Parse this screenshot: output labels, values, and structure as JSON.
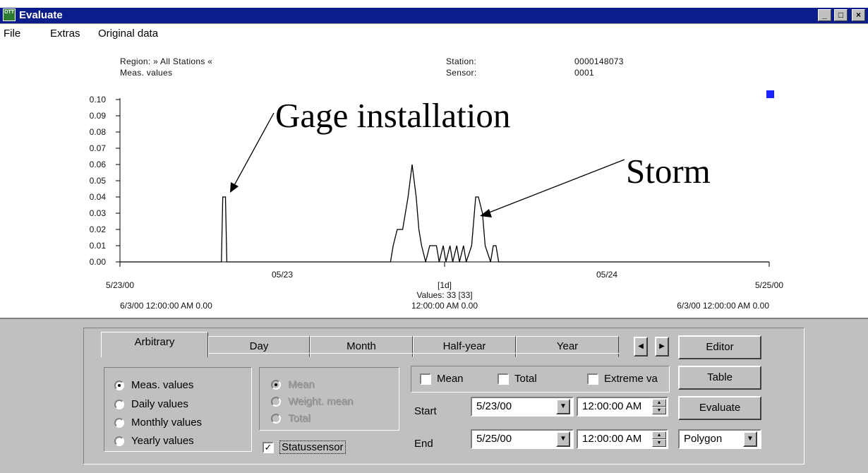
{
  "window": {
    "title": "Evaluate",
    "app_icon_text": "OTT",
    "controls": [
      "_",
      "□",
      "×"
    ]
  },
  "menu": {
    "items": [
      "File",
      "Extras",
      "Original data"
    ]
  },
  "header": {
    "region_label": "Region: » All Stations «",
    "type_label": "Meas. values",
    "station_label": "Station:",
    "station_value": "0000148073",
    "sensor_label": "Sensor:",
    "sensor_value": "0001"
  },
  "chart_data": {
    "type": "line",
    "y_ticks": [
      "0.10",
      "0.09",
      "0.08",
      "0.07",
      "0.06",
      "0.05",
      "0.04",
      "0.03",
      "0.02",
      "0.01",
      "0.00"
    ],
    "ylim": [
      0,
      0.1
    ],
    "xlim": [
      0,
      48
    ],
    "x_tick_labels": [
      {
        "x": 12,
        "label": "05/23"
      },
      {
        "x": 36,
        "label": "05/24"
      }
    ],
    "x_start_label": "5/23/00",
    "x_end_label": "5/25/00",
    "center_label": "[1d]",
    "values_label": "Values: 33 [33]",
    "left_footer": "6/3/00 12:00:00 AM  0.00",
    "center_footer": "12:00:00 AM  0.00",
    "right_footer": "6/3/00 12:00:00 AM  0.00",
    "x": [
      0,
      7.5,
      7.6,
      7.7,
      7.8,
      7.9,
      8.0,
      20.0,
      20.2,
      20.5,
      20.9,
      21.3,
      21.6,
      21.9,
      22.1,
      22.3,
      22.6,
      22.9,
      23.1,
      23.4,
      23.6,
      23.9,
      24.1,
      24.4,
      24.6,
      24.9,
      25.1,
      25.4,
      25.6,
      26.0,
      26.3,
      26.5,
      26.8,
      27.0,
      27.4,
      27.6,
      27.8,
      28.0,
      48
    ],
    "values": [
      0,
      0,
      0.04,
      0.04,
      0.04,
      0.0,
      0,
      0,
      0.01,
      0.02,
      0.02,
      0.04,
      0.06,
      0.04,
      0.02,
      0.01,
      0.0,
      0.01,
      0.01,
      0.01,
      0.0,
      0.01,
      0.0,
      0.01,
      0.0,
      0.01,
      0.0,
      0.01,
      0.0,
      0.01,
      0.04,
      0.04,
      0.03,
      0.01,
      0.0,
      0.01,
      0.01,
      0.0,
      0
    ],
    "annotations": [
      "Gage installation",
      "Storm"
    ],
    "series_color": "#000000",
    "legend_marker_color": "#1a22ff"
  },
  "tabs": [
    "Arbitrary",
    "Day",
    "Month",
    "Half-year",
    "Year"
  ],
  "buttons": {
    "editor": "Editor",
    "table": "Table",
    "evaluate": "Evaluate"
  },
  "value_type": {
    "options": [
      "Meas. values",
      "Daily values",
      "Monthly values",
      "Yearly values"
    ],
    "selected": "Meas. values"
  },
  "aggregate": {
    "options": [
      "Mean",
      "Weight. mean",
      "Total"
    ]
  },
  "statussensor": {
    "label": "Statussensor",
    "checked": true
  },
  "checks": {
    "mean": "Mean",
    "total": "Total",
    "extreme": "Extreme va"
  },
  "range": {
    "start_label": "Start",
    "end_label": "End",
    "start_date": "5/23/00",
    "start_time": "12:00:00 AM",
    "end_date": "5/25/00",
    "end_time": "12:00:00 AM",
    "chart_type": "Polygon"
  }
}
